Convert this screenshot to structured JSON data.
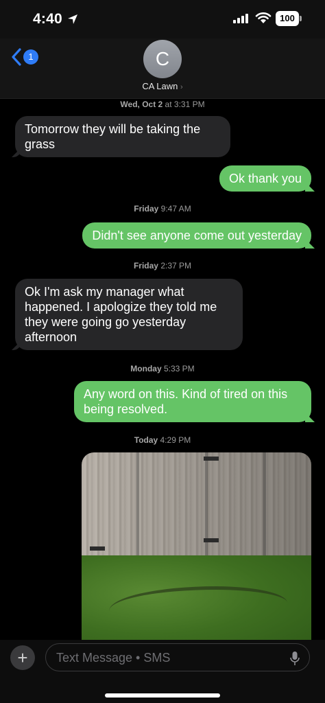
{
  "status_bar": {
    "time": "4:40",
    "battery": "100"
  },
  "header": {
    "back_badge": "1",
    "avatar_initial": "C",
    "contact_name": "CA Lawn",
    "contact_chevron": "›"
  },
  "messages": [
    {
      "type": "timestamp",
      "day": "Wed, Oct 2",
      "at": "at 3:31 PM"
    },
    {
      "type": "incoming",
      "text": "Tomorrow they will be   taking the grass"
    },
    {
      "type": "outgoing",
      "text": "Ok thank you"
    },
    {
      "type": "timestamp",
      "day": "Friday",
      "at": "9:47 AM"
    },
    {
      "type": "outgoing",
      "text": "Didn't see anyone come out yesterday"
    },
    {
      "type": "timestamp",
      "day": "Friday",
      "at": "2:37 PM"
    },
    {
      "type": "incoming",
      "text": "Ok I'm ask my manager what happened.  I apologize they told me they were going go yesterday afternoon"
    },
    {
      "type": "timestamp",
      "day": "Monday",
      "at": "5:33 PM"
    },
    {
      "type": "outgoing",
      "text": "Any word on this. Kind of tired on this being resolved."
    },
    {
      "type": "timestamp",
      "day": "Today",
      "at": "4:29 PM"
    }
  ],
  "composer": {
    "plus": "+",
    "placeholder": "Text Message • SMS"
  },
  "colors": {
    "outgoing_bubble": "#65c466",
    "incoming_bubble": "#262628",
    "accent": "#2f7cf6"
  },
  "icons": [
    "location-arrow-icon",
    "signal-icon",
    "wifi-icon",
    "battery-icon",
    "back-chevron-icon",
    "mic-icon",
    "plus-icon"
  ]
}
